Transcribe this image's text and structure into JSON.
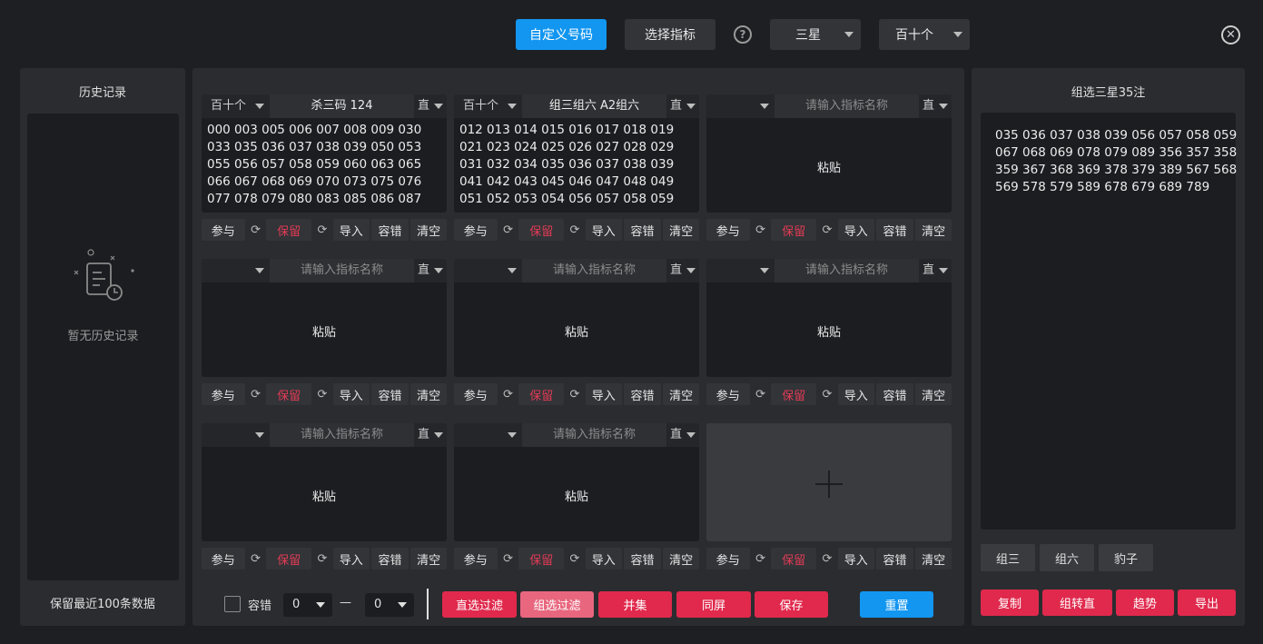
{
  "topbar": {
    "custom_button": "自定义号码",
    "select_button": "选择指标",
    "help_icon": "?",
    "star_select": "三星",
    "digit_select": "百十个",
    "close_icon": "✕"
  },
  "history": {
    "title": "历史记录",
    "empty": "暂无历史记录",
    "footer": "保留最近100条数据"
  },
  "actions": {
    "join": "参与",
    "refresh_icon": "⟳",
    "keep": "保留",
    "import": "导入",
    "tolerance": "容错",
    "clear": "清空"
  },
  "cards": [
    {
      "sel": "百十个",
      "name": "杀三码 124",
      "placeholder": false,
      "dir": "直",
      "numbers": "000 003 005 006 007 008 009 030\n033 035 036 037 038 039 050 053\n055 056 057 058 059 060 063 065\n066 067 068 069 070 073 075 076\n077 078 079 080 083 085 086 087"
    },
    {
      "sel": "百十个",
      "name": "组三组六 A2组六",
      "placeholder": false,
      "dir": "直",
      "numbers": "012 013 014 015 016 017 018 019\n021 023 024 025 026 027 028 029\n031 032 034 035 036 037 038 039\n041 042 043 045 046 047 048 049\n051 052 053 054 056 057 058 059"
    },
    {
      "sel": "",
      "name": "请输入指标名称",
      "placeholder": true,
      "dir": "直",
      "paste": "粘贴"
    },
    {
      "sel": "",
      "name": "请输入指标名称",
      "placeholder": true,
      "dir": "直",
      "paste": "粘贴"
    },
    {
      "sel": "",
      "name": "请输入指标名称",
      "placeholder": true,
      "dir": "直",
      "paste": "粘贴"
    },
    {
      "sel": "",
      "name": "请输入指标名称",
      "placeholder": true,
      "dir": "直",
      "paste": "粘贴"
    },
    {
      "sel": "",
      "name": "请输入指标名称",
      "placeholder": true,
      "dir": "直",
      "paste": "粘贴"
    },
    {
      "sel": "",
      "name": "请输入指标名称",
      "placeholder": true,
      "dir": "直",
      "paste": "粘贴"
    }
  ],
  "bottom": {
    "tolerance_label": "容错",
    "min": "0",
    "dash": "—",
    "max": "0",
    "direct_filter": "直选过滤",
    "group_filter": "组选过滤",
    "union": "并集",
    "same_screen": "同屏",
    "save": "保存",
    "reset": "重置"
  },
  "result": {
    "title": "组选三星35注",
    "numbers": "035 036 037 038 039 056 057 058 059\n067 068 069 078 079 089 356 357 358\n359 367 368 369 378 379 389 567 568\n569 578 579 589 678 679 689 789",
    "group3": "组三",
    "group6": "组六",
    "leopard": "豹子",
    "copy": "复制",
    "to_direct": "组转直",
    "trend": "趋势",
    "export": "导出"
  },
  "colors": {
    "primary_blue": "#1296f0",
    "danger_red": "#e0294c",
    "keep_red": "#e23b55"
  }
}
